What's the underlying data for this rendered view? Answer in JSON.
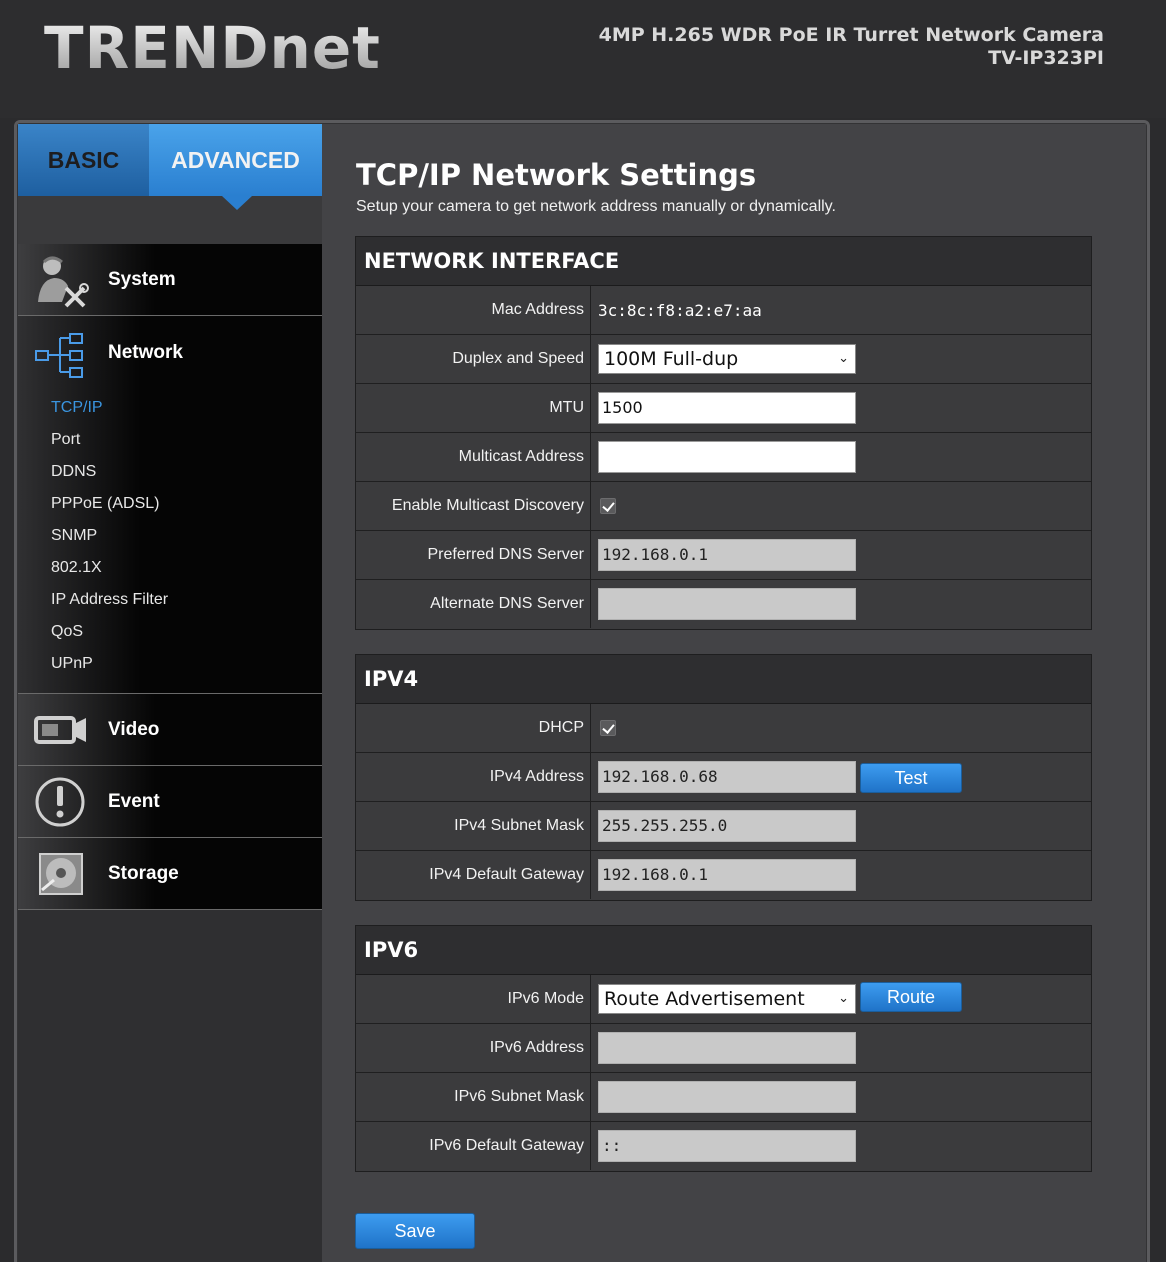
{
  "header": {
    "logo": "TRENDnet",
    "product_line": "4MP H.265 WDR PoE IR Turret Network Camera",
    "model": "TV-IP323PI"
  },
  "tabs": {
    "basic": "BASIC",
    "advanced": "ADVANCED"
  },
  "nav": {
    "system": "System",
    "network": "Network",
    "network_items": [
      "TCP/IP",
      "Port",
      "DDNS",
      "PPPoE (ADSL)",
      "SNMP",
      "802.1X",
      "IP Address Filter",
      "QoS",
      "UPnP"
    ],
    "video": "Video",
    "event": "Event",
    "storage": "Storage"
  },
  "page": {
    "title": "TCP/IP Network Settings",
    "subtitle": "Setup your camera to get network address manually or dynamically."
  },
  "network_interface": {
    "heading": "NETWORK INTERFACE",
    "mac_label": "Mac Address",
    "mac_value": "3c:8c:f8:a2:e7:aa",
    "duplex_label": "Duplex and Speed",
    "duplex_value": "100M Full-dup",
    "mtu_label": "MTU",
    "mtu_value": "1500",
    "multicast_label": "Multicast Address",
    "multicast_value": "",
    "multicast_discovery_label": "Enable Multicast Discovery",
    "multicast_discovery_checked": true,
    "dns1_label": "Preferred DNS Server",
    "dns1_value": "192.168.0.1",
    "dns2_label": "Alternate DNS Server",
    "dns2_value": ""
  },
  "ipv4": {
    "heading": "IPV4",
    "dhcp_label": "DHCP",
    "dhcp_checked": true,
    "address_label": "IPv4 Address",
    "address_value": "192.168.0.68",
    "test_button": "Test",
    "mask_label": "IPv4 Subnet Mask",
    "mask_value": "255.255.255.0",
    "gateway_label": "IPv4 Default Gateway",
    "gateway_value": "192.168.0.1"
  },
  "ipv6": {
    "heading": "IPV6",
    "mode_label": "IPv6 Mode",
    "mode_value": "Route Advertisement",
    "route_button": "Route",
    "address_label": "IPv6 Address",
    "address_value": "",
    "mask_label": "IPv6 Subnet Mask",
    "mask_value": "",
    "gateway_label": "IPv6 Default Gateway",
    "gateway_value": "::"
  },
  "save_button": "Save",
  "colors": {
    "accent": "#2a7fd0",
    "active_nav": "#3a95e0"
  }
}
